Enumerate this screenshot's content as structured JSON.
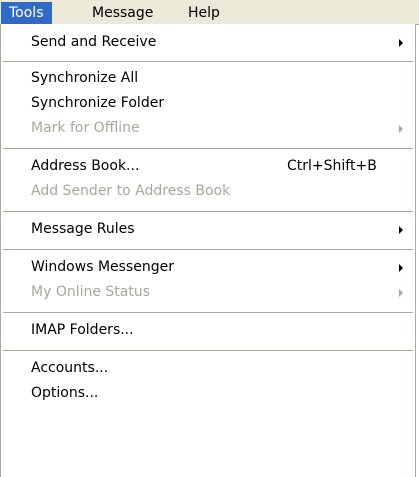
{
  "menubar": {
    "items": [
      {
        "label": "Tools"
      },
      {
        "label": "Message"
      },
      {
        "label": "Help"
      }
    ]
  },
  "dropdown": {
    "items": [
      {
        "label": "Send and Receive",
        "disabled": false,
        "submenu": true,
        "shortcut": ""
      },
      {
        "label": "Synchronize All",
        "disabled": false,
        "submenu": false,
        "shortcut": ""
      },
      {
        "label": "Synchronize Folder",
        "disabled": false,
        "submenu": false,
        "shortcut": ""
      },
      {
        "label": "Mark for Offline",
        "disabled": true,
        "submenu": true,
        "shortcut": ""
      },
      {
        "label": "Address Book...",
        "disabled": false,
        "submenu": false,
        "shortcut": "Ctrl+Shift+B"
      },
      {
        "label": "Add Sender to Address Book",
        "disabled": true,
        "submenu": false,
        "shortcut": ""
      },
      {
        "label": "Message Rules",
        "disabled": false,
        "submenu": true,
        "shortcut": ""
      },
      {
        "label": "Windows Messenger",
        "disabled": false,
        "submenu": true,
        "shortcut": ""
      },
      {
        "label": "My Online Status",
        "disabled": true,
        "submenu": true,
        "shortcut": ""
      },
      {
        "label": "IMAP Folders...",
        "disabled": false,
        "submenu": false,
        "shortcut": ""
      },
      {
        "label": "Accounts...",
        "disabled": false,
        "submenu": false,
        "shortcut": ""
      },
      {
        "label": "Options...",
        "disabled": false,
        "submenu": false,
        "shortcut": ""
      }
    ]
  },
  "colors": {
    "menubar_bg": "#ece9d8",
    "highlight": "#316ac5",
    "disabled_text": "#a9a69a",
    "separator": "#aca899"
  }
}
